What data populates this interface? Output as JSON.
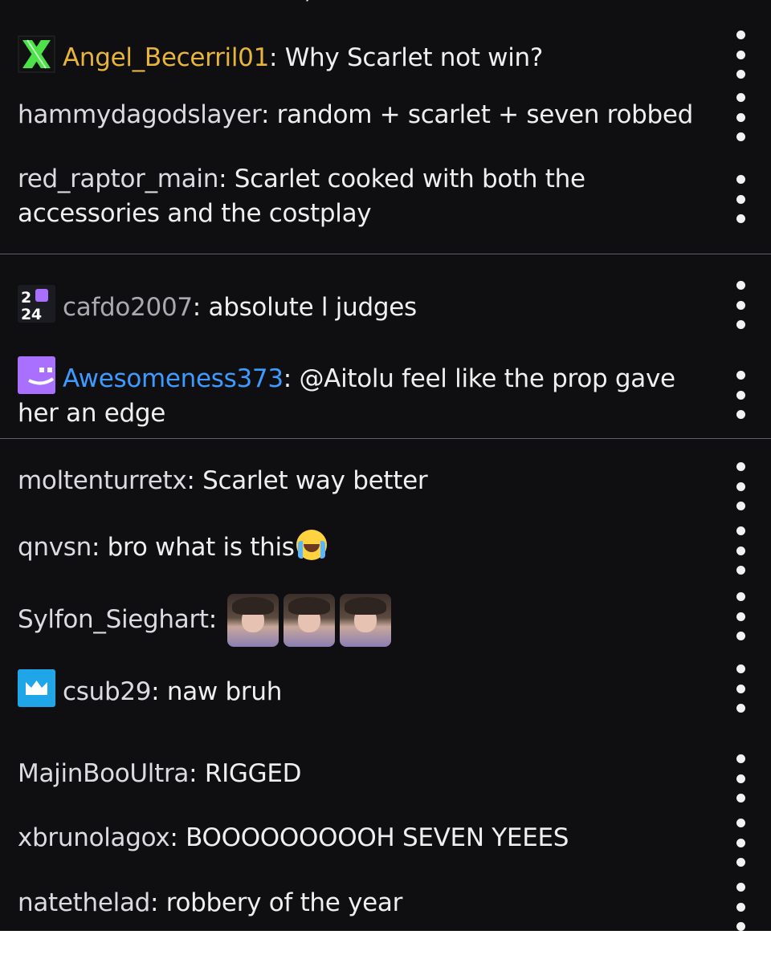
{
  "colors": {
    "background": "#0f0f12",
    "divider": "#5f5f66",
    "text": "#efeff1",
    "gold_user": "#e7b43c",
    "blue_user": "#3d9bff",
    "grey_user": "#a9a9b0",
    "purple_badge": "#a970ff",
    "blue_badge": "#1fa6e8",
    "green_badge": "#4de14a"
  },
  "chat": {
    "messages": [
      {
        "user": "Angel_Becerril01",
        "text": ": Why Scarlet not win?",
        "badge": "x-icon",
        "user_color": "#e7b43c"
      },
      {
        "user": "hammydagodslayer",
        "text": ": random + scarlet + seven robbed"
      },
      {
        "user": "red_raptor_main",
        "text": ": Scarlet cooked with both the accessories and the costplay"
      },
      {
        "user": "cafdo2007",
        "text": ": absolute l judges",
        "badge": "2024-badge-icon",
        "user_color": "#a9a9b0"
      },
      {
        "user": "Awesomeness373",
        "text": ": @Aitolu feel like the prop gave her an edge",
        "badge": "glitch-face-icon",
        "user_color": "#3d9bff"
      },
      {
        "user": "moltenturretx",
        "text": ": Scarlet way better"
      },
      {
        "user": "qnvsn",
        "text": ": bro what is this",
        "emoji": "loudly-crying-face-icon"
      },
      {
        "user": "Sylfon_Sieghart",
        "text": ":",
        "emotes": [
          "stressed-man-emote",
          "stressed-man-emote",
          "stressed-man-emote"
        ]
      },
      {
        "user": "csub29",
        "text": ": naw bruh",
        "badge": "crown-icon"
      },
      {
        "user": "MajinBooUltra",
        "text": ": RIGGED"
      },
      {
        "user": "xbrunolagox",
        "text": ": BOOOOOOOOOH SEVEN YEEES"
      },
      {
        "user": "natethelad",
        "text": ": robbery of the year"
      }
    ]
  }
}
